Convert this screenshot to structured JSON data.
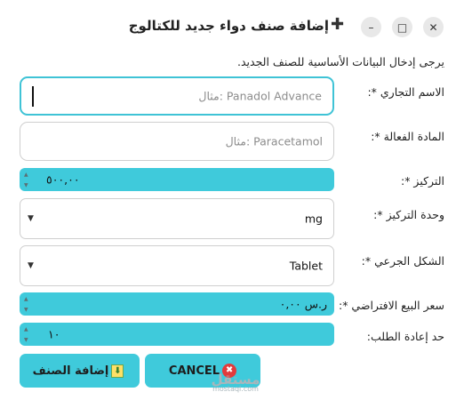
{
  "window": {
    "title": "إضافة صنف دواء جديد للكتالوج",
    "title_icon": "plus-icon",
    "close_glyph": "✕",
    "maximize_glyph": "□",
    "minimize_glyph": "–"
  },
  "instruction": "يرجى إدخال البيانات الأساسية للصنف الجديد.",
  "form": {
    "trade_name": {
      "label": "الاسم التجاري *:",
      "placeholder": "مثال: Panadol Advance",
      "value": ""
    },
    "active_ingredient": {
      "label": "المادة الفعالة *:",
      "placeholder": "مثال: Paracetamol",
      "value": ""
    },
    "concentration": {
      "label": "التركيز *:",
      "value": "٥٠٠,٠٠"
    },
    "concentration_unit": {
      "label": "وحدة التركيز *:",
      "value": "mg"
    },
    "dosage_form": {
      "label": "الشكل الجرعي *:",
      "value": "Tablet"
    },
    "default_price": {
      "label": "سعر البيع الافتراضي *:",
      "value": "ر.س ٠,٠٠"
    },
    "reorder_level": {
      "label": "حد إعادة الطلب:",
      "value": "١٠"
    }
  },
  "buttons": {
    "add": {
      "label": "إضافة الصنف",
      "icon": "download-arrow-icon"
    },
    "cancel": {
      "label": "CANCEL",
      "icon": "cancel-x-icon"
    }
  },
  "spinner_arrows": {
    "up": "▲",
    "down": "▼"
  },
  "select_arrow": "▼",
  "watermark": {
    "arabic": "مستقل",
    "latin": "mostaql.com"
  },
  "colors": {
    "accent": "#3fcadb",
    "focus_border": "#3fc3d6",
    "cancel_icon": "#e23b3b"
  }
}
